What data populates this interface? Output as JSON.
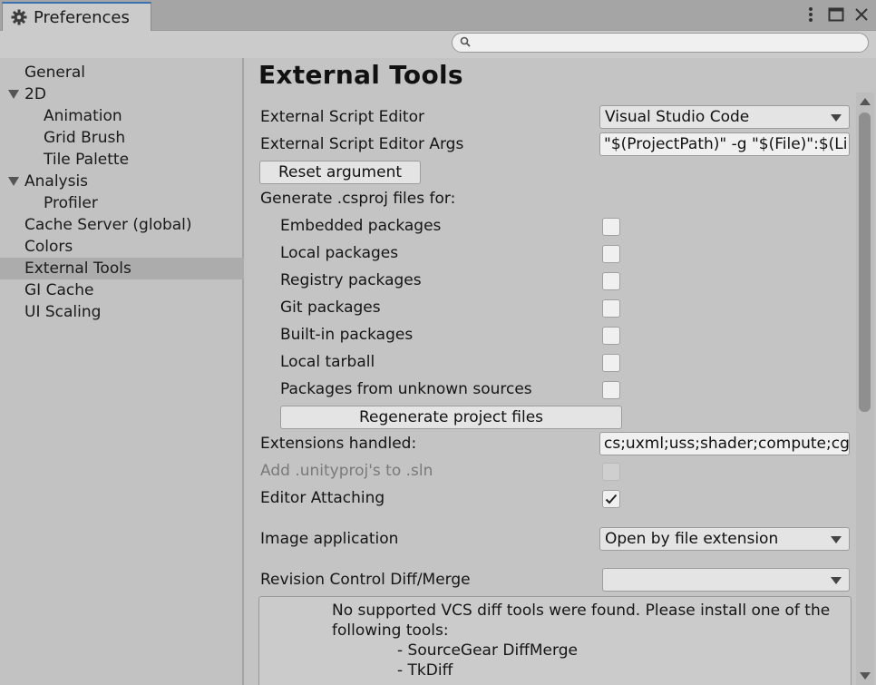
{
  "window": {
    "tab_title": "Preferences",
    "icons": [
      "gear-icon",
      "more-icon",
      "maximize-icon",
      "close-icon"
    ]
  },
  "search": {
    "placeholder": "",
    "value": ""
  },
  "sidebar": {
    "items": [
      {
        "label": "General",
        "indent": 0,
        "expandable": false,
        "selected": false
      },
      {
        "label": "2D",
        "indent": 0,
        "expandable": true,
        "selected": false
      },
      {
        "label": "Animation",
        "indent": 1,
        "expandable": false,
        "selected": false
      },
      {
        "label": "Grid Brush",
        "indent": 1,
        "expandable": false,
        "selected": false
      },
      {
        "label": "Tile Palette",
        "indent": 1,
        "expandable": false,
        "selected": false
      },
      {
        "label": "Analysis",
        "indent": 0,
        "expandable": true,
        "selected": false
      },
      {
        "label": "Profiler",
        "indent": 1,
        "expandable": false,
        "selected": false
      },
      {
        "label": "Cache Server (global)",
        "indent": 0,
        "expandable": false,
        "selected": false
      },
      {
        "label": "Colors",
        "indent": 0,
        "expandable": false,
        "selected": false
      },
      {
        "label": "External Tools",
        "indent": 0,
        "expandable": false,
        "selected": true
      },
      {
        "label": "GI Cache",
        "indent": 0,
        "expandable": false,
        "selected": false
      },
      {
        "label": "UI Scaling",
        "indent": 0,
        "expandable": false,
        "selected": false
      }
    ]
  },
  "main": {
    "title": "External Tools",
    "script_editor": {
      "label": "External Script Editor",
      "value": "Visual Studio Code"
    },
    "script_editor_args": {
      "label": "External Script Editor Args",
      "value": "\"$(ProjectPath)\" -g \"$(File)\":$(Line):$(Column)"
    },
    "reset_argument_label": "Reset argument",
    "generate_csproj_label": "Generate .csproj files for:",
    "packages": [
      {
        "label": "Embedded packages",
        "checked": false
      },
      {
        "label": "Local packages",
        "checked": false
      },
      {
        "label": "Registry packages",
        "checked": false
      },
      {
        "label": "Git packages",
        "checked": false
      },
      {
        "label": "Built-in packages",
        "checked": false
      },
      {
        "label": "Local tarball",
        "checked": false
      },
      {
        "label": "Packages from unknown sources",
        "checked": false
      }
    ],
    "regenerate_label": "Regenerate project files",
    "extensions": {
      "label": "Extensions handled:",
      "value": "cs;uxml;uss;shader;compute;cginc;hlsl;glslinc;template;raytrace"
    },
    "add_unityproj": {
      "label": "Add .unityproj's to .sln",
      "checked": false,
      "disabled": true
    },
    "editor_attaching": {
      "label": "Editor Attaching",
      "checked": true
    },
    "image_application": {
      "label": "Image application",
      "value": "Open by file extension"
    },
    "revision_control": {
      "label": "Revision Control Diff/Merge",
      "value": ""
    },
    "help": {
      "line1": "No supported VCS diff tools were found. Please install one of the",
      "line2": "following tools:",
      "tool1": "- SourceGear DiffMerge",
      "tool2": "- TkDiff"
    }
  }
}
